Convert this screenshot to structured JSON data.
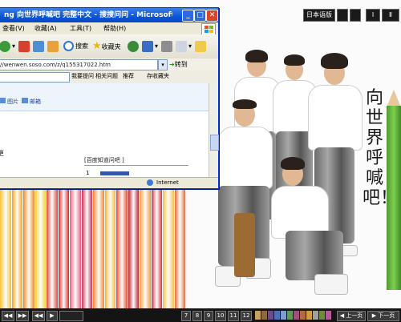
{
  "wallpaper": {
    "tagline": "向世界呼喊吧！",
    "site_controls": [
      "日本语版",
      "",
      "",
      "Ⅰ",
      "Ⅱ"
    ],
    "pencil_colors": [
      "#f6c232",
      "#f2a51e",
      "#ef8a1c",
      "#f3d338",
      "#e1463b",
      "#d92b2b",
      "#ea5e7c",
      "#c93556",
      "#f08a2c",
      "#f7b629",
      "#e84b2a",
      "#b82b35",
      "#f29b3a",
      "#d33847",
      "#f4c24a",
      "#e66c3a"
    ],
    "bottom_swatch_colors": [
      "#c6a15b",
      "#8d6b3a",
      "#6c4b8a",
      "#4d6fb3",
      "#7e9ccf",
      "#5e9b58",
      "#9e4f7a",
      "#b36b3c",
      "#cf9f3d",
      "#a0a0a0",
      "#6f8a3c",
      "#b35c9a"
    ],
    "bottom_numbers": [
      "7",
      "8",
      "9",
      "10",
      "11",
      "12"
    ],
    "bottom_left_labels": [
      "◀◀",
      "▶▶",
      "◀◀",
      "▶"
    ],
    "bottom_right_labels": [
      "◀ 上一页",
      "▶ 下一页"
    ]
  },
  "ie": {
    "title": "ng 向世界呼喊吧 完整中文 - 搜搜问问 - Microsoft Inter...",
    "menu": [
      "查看(V)",
      "收藏(A)",
      "工具(T)",
      "帮助(H)"
    ],
    "toolbar": {
      "search_label": "搜索",
      "favorites_label": "收藏夹"
    },
    "address": {
      "url": "//wenwen.soso.com/z/q155317022.htm",
      "go_label": "转到"
    },
    "links": {
      "search_label": "搜索",
      "answer_label": "我要提问",
      "related_label": "相关问题",
      "recommend_label": "推荐",
      "bookmark_label": "存收藏夹"
    },
    "page": {
      "link1": "图片",
      "link2": "邮箱",
      "snippet": "更",
      "box_title": "[百度知道问吧 ]",
      "box_marker": "1"
    },
    "status": {
      "zone": "Internet"
    }
  }
}
